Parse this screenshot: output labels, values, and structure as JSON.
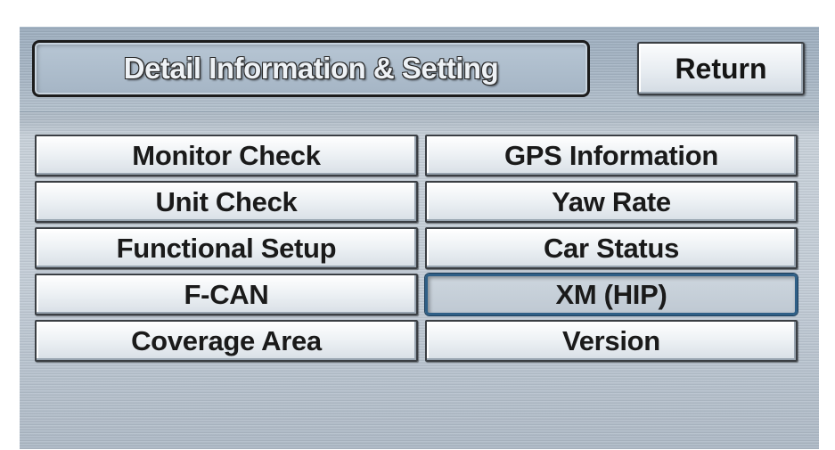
{
  "header": {
    "title": "Detail Information & Setting",
    "return_label": "Return"
  },
  "menu": {
    "items": [
      {
        "label": "Monitor Check"
      },
      {
        "label": "GPS Information"
      },
      {
        "label": "Unit Check"
      },
      {
        "label": "Yaw Rate"
      },
      {
        "label": "Functional Setup"
      },
      {
        "label": "Car Status"
      },
      {
        "label": "F-CAN"
      },
      {
        "label": "XM (HIP)",
        "selected": true
      },
      {
        "label": "Coverage Area"
      },
      {
        "label": "Version"
      }
    ]
  },
  "colors": {
    "screen_bg": "#c4ced8",
    "button_face": "#eef2f5",
    "selected_border": "#2f5f86",
    "title_text": "#eef2f6"
  }
}
